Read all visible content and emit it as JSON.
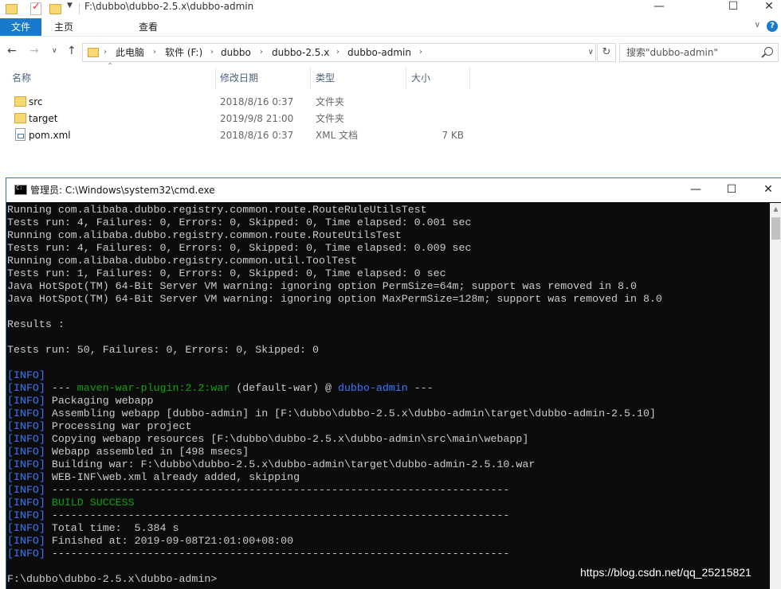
{
  "explorer": {
    "title": "F:\\dubbo\\dubbo-2.5.x\\dubbo-admin",
    "tabs": [
      "文件",
      "主页",
      "查看"
    ],
    "breadcrumb": [
      "此电脑",
      "软件 (F:)",
      "dubbo",
      "dubbo-2.5.x",
      "dubbo-admin"
    ],
    "search_placeholder": "搜索\"dubbo-admin\"",
    "columns": {
      "name": "名称",
      "date": "修改日期",
      "type": "类型",
      "size": "大小"
    },
    "files": [
      {
        "name": "src",
        "date": "2018/8/16 0:37",
        "type": "文件夹",
        "size": "",
        "icon": "folder-icon"
      },
      {
        "name": "target",
        "date": "2019/9/8 21:00",
        "type": "文件夹",
        "size": "",
        "icon": "folder-icon"
      },
      {
        "name": "pom.xml",
        "date": "2018/8/16 0:37",
        "type": "XML 文档",
        "size": "7 KB",
        "icon": "xml-file-icon"
      }
    ]
  },
  "cmd": {
    "title": "管理员: C:\\Windows\\system32\\cmd.exe",
    "lines": [
      "Running com.alibaba.dubbo.registry.common.route.RouteRuleUtilsTest",
      "Tests run: 4, Failures: 0, Errors: 0, Skipped: 0, Time elapsed: 0.001 sec",
      "Running com.alibaba.dubbo.registry.common.route.RouteUtilsTest",
      "Tests run: 4, Failures: 0, Errors: 0, Skipped: 0, Time elapsed: 0.009 sec",
      "Running com.alibaba.dubbo.registry.common.util.ToolTest",
      "Tests run: 1, Failures: 0, Errors: 0, Skipped: 0, Time elapsed: 0 sec",
      "Java HotSpot(TM) 64-Bit Server VM warning: ignoring option PermSize=64m; support was removed in 8.0",
      "Java HotSpot(TM) 64-Bit Server VM warning: ignoring option MaxPermSize=128m; support was removed in 8.0",
      "",
      "Results :",
      "",
      "Tests run: 50, Failures: 0, Errors: 0, Skipped: 0",
      "",
      "[INFO]",
      "[INFO] --- maven-war-plugin:2.2:war (default-war) @ dubbo-admin ---",
      "[INFO] Packaging webapp",
      "[INFO] Assembling webapp [dubbo-admin] in [F:\\dubbo\\dubbo-2.5.x\\dubbo-admin\\target\\dubbo-admin-2.5.10]",
      "[INFO] Processing war project",
      "[INFO] Copying webapp resources [F:\\dubbo\\dubbo-2.5.x\\dubbo-admin\\src\\main\\webapp]",
      "[INFO] Webapp assembled in [498 msecs]",
      "[INFO] Building war: F:\\dubbo\\dubbo-2.5.x\\dubbo-admin\\target\\dubbo-admin-2.5.10.war",
      "[INFO] WEB-INF\\web.xml already added, skipping",
      "[INFO] ------------------------------------------------------------------------",
      "[INFO] BUILD SUCCESS",
      "[INFO] ------------------------------------------------------------------------",
      "[INFO] Total time:  5.384 s",
      "[INFO] Finished at: 2019-09-08T21:01:00+08:00",
      "[INFO] ------------------------------------------------------------------------",
      "",
      "F:\\dubbo\\dubbo-2.5.x\\dubbo-admin>"
    ]
  },
  "watermark": "https://blog.csdn.net/qq_25215821",
  "colors": {
    "accent": "#1979ca",
    "console_bg": "#0c0c0c",
    "console_text": "#cccccc",
    "info": "#3b78ff",
    "success": "#13a10e"
  }
}
